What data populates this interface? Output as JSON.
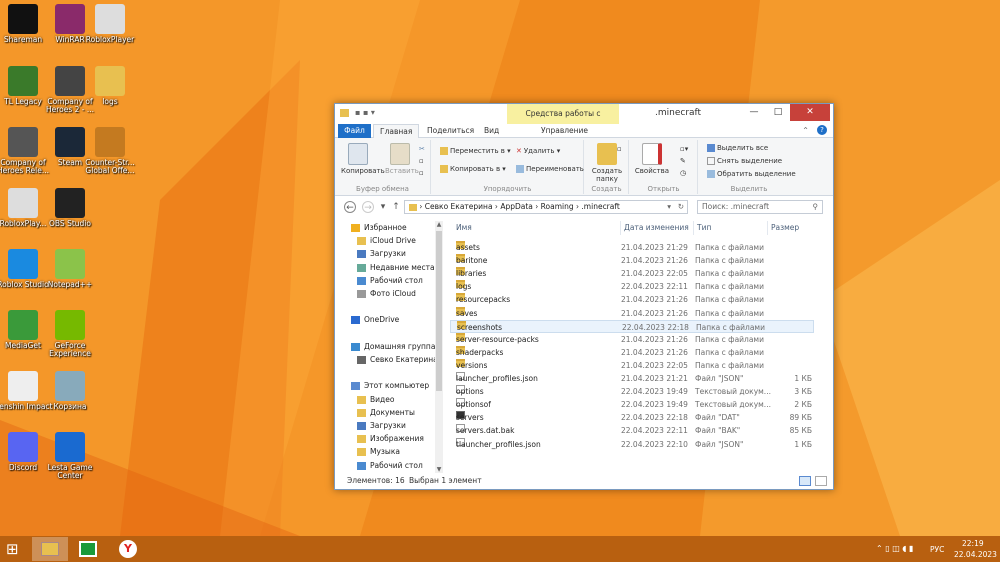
{
  "desktop_icons": [
    {
      "label": "Shareman",
      "color": "#111"
    },
    {
      "label": "WinRAR",
      "color": "#8a2a6a"
    },
    {
      "label": "RobloxPlayer",
      "color": "#ddd"
    },
    {
      "label": "TL Legacy",
      "color": "#3a7a2a"
    },
    {
      "label": "Company of Heroes 2 - ...",
      "color": "#444"
    },
    {
      "label": "logs",
      "color": "#e8c050"
    },
    {
      "label": "Company of Heroes Rele...",
      "color": "#555"
    },
    {
      "label": "Steam",
      "color": "#1b2838"
    },
    {
      "label": "Counter-Str... Global Offe...",
      "color": "#c47a20"
    },
    {
      "label": "RobloxPlay...",
      "color": "#ddd"
    },
    {
      "label": "OBS Studio",
      "color": "#222"
    },
    {
      "label": "Roblox Studio",
      "color": "#1a8ae0"
    },
    {
      "label": "Notepad++",
      "color": "#8bc34a"
    },
    {
      "label": "MediaGet",
      "color": "#3a9a3a"
    },
    {
      "label": "GeForce Experience",
      "color": "#76b900"
    },
    {
      "label": "Genshin Impact",
      "color": "#eee"
    },
    {
      "label": "Корзина",
      "color": "#8ab"
    },
    {
      "label": "Discord",
      "color": "#5865f2"
    },
    {
      "label": "Lesta Game Center",
      "color": "#1a6ad0"
    }
  ],
  "window": {
    "title": ".minecraft",
    "context_tab": "Средства работы с рисунками",
    "tabs": [
      "Файл",
      "Главная",
      "Поделиться",
      "Вид",
      "Управление"
    ],
    "ribbon": {
      "copy": "Копировать",
      "paste": "Вставить",
      "clipboard": "Буфер обмена",
      "move_to": "Переместить в",
      "copy_to": "Копировать в",
      "delete": "Удалить",
      "rename": "Переименовать",
      "organize": "Упорядочить",
      "new_folder": "Создать папку",
      "create": "Создать",
      "properties": "Свойства",
      "open": "Открыть",
      "select_all": "Выделить все",
      "select_none": "Снять выделение",
      "invert": "Обратить выделение",
      "select": "Выделить"
    },
    "path": [
      "Севко Екатерина",
      "AppData",
      "Roaming",
      ".minecraft"
    ],
    "search_placeholder": "Поиск: .minecraft",
    "nav": [
      {
        "label": "Избранное",
        "icon": "star-icon",
        "indent": 0
      },
      {
        "label": "iCloud Drive",
        "icon": "folder-icon",
        "indent": 1
      },
      {
        "label": "Загрузки",
        "icon": "download-icon",
        "indent": 1
      },
      {
        "label": "Недавние места",
        "icon": "recent-icon",
        "indent": 1
      },
      {
        "label": "Рабочий стол",
        "icon": "desktop-icon",
        "indent": 1
      },
      {
        "label": "Фото iCloud",
        "icon": "photo-icon",
        "indent": 1
      },
      {
        "label": "",
        "icon": "",
        "indent": 0
      },
      {
        "label": "OneDrive",
        "icon": "cloud-icon",
        "indent": 0
      },
      {
        "label": "",
        "icon": "",
        "indent": 0
      },
      {
        "label": "Домашняя группа",
        "icon": "homegroup-icon",
        "indent": 0
      },
      {
        "label": "Севко Екатерина",
        "icon": "user-icon",
        "indent": 1
      },
      {
        "label": "",
        "icon": "",
        "indent": 0
      },
      {
        "label": "Этот компьютер",
        "icon": "computer-icon",
        "indent": 0
      },
      {
        "label": "Видео",
        "icon": "video-icon",
        "indent": 1
      },
      {
        "label": "Документы",
        "icon": "documents-icon",
        "indent": 1
      },
      {
        "label": "Загрузки",
        "icon": "download-icon",
        "indent": 1
      },
      {
        "label": "Изображения",
        "icon": "pictures-icon",
        "indent": 1
      },
      {
        "label": "Музыка",
        "icon": "music-icon",
        "indent": 1
      },
      {
        "label": "Рабочий стол",
        "icon": "desktop-icon",
        "indent": 1
      }
    ],
    "columns": [
      "Имя",
      "Дата изменения",
      "Тип",
      "Размер"
    ],
    "files": [
      {
        "name": "assets",
        "date": "21.04.2023 21:29",
        "type": "Папка с файлами",
        "size": "",
        "kind": "folder"
      },
      {
        "name": "baritone",
        "date": "21.04.2023 21:26",
        "type": "Папка с файлами",
        "size": "",
        "kind": "folder"
      },
      {
        "name": "libraries",
        "date": "21.04.2023 22:05",
        "type": "Папка с файлами",
        "size": "",
        "kind": "folder"
      },
      {
        "name": "logs",
        "date": "22.04.2023 22:11",
        "type": "Папка с файлами",
        "size": "",
        "kind": "folder"
      },
      {
        "name": "resourcepacks",
        "date": "21.04.2023 21:26",
        "type": "Папка с файлами",
        "size": "",
        "kind": "folder"
      },
      {
        "name": "saves",
        "date": "21.04.2023 21:26",
        "type": "Папка с файлами",
        "size": "",
        "kind": "folder"
      },
      {
        "name": "screenshots",
        "date": "22.04.2023 22:18",
        "type": "Папка с файлами",
        "size": "",
        "kind": "folder",
        "selected": true
      },
      {
        "name": "server-resource-packs",
        "date": "21.04.2023 21:26",
        "type": "Папка с файлами",
        "size": "",
        "kind": "folder"
      },
      {
        "name": "shaderpacks",
        "date": "21.04.2023 21:26",
        "type": "Папка с файлами",
        "size": "",
        "kind": "folder"
      },
      {
        "name": "versions",
        "date": "21.04.2023 22:05",
        "type": "Папка с файлами",
        "size": "",
        "kind": "folder"
      },
      {
        "name": "launcher_profiles.json",
        "date": "21.04.2023 21:21",
        "type": "Файл \"JSON\"",
        "size": "1 КБ",
        "kind": "file"
      },
      {
        "name": "options",
        "date": "22.04.2023 19:49",
        "type": "Текстовый докум...",
        "size": "3 КБ",
        "kind": "file"
      },
      {
        "name": "optionsof",
        "date": "22.04.2023 19:49",
        "type": "Текстовый докум...",
        "size": "2 КБ",
        "kind": "file"
      },
      {
        "name": "servers",
        "date": "22.04.2023 22:18",
        "type": "Файл \"DAT\"",
        "size": "89 КБ",
        "kind": "dark"
      },
      {
        "name": "servers.dat.bak",
        "date": "22.04.2023 22:11",
        "type": "Файл \"BAK\"",
        "size": "85 КБ",
        "kind": "file"
      },
      {
        "name": "tlauncher_profiles.json",
        "date": "22.04.2023 22:10",
        "type": "Файл \"JSON\"",
        "size": "1 КБ",
        "kind": "file"
      }
    ],
    "status_count": "Элементов: 16",
    "status_selected": "Выбран 1 элемент"
  },
  "taskbar": {
    "lang": "РУС",
    "time": "22:19",
    "date": "22.04.2023"
  }
}
